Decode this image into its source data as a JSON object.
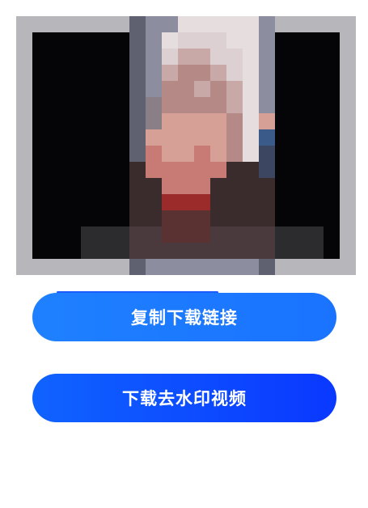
{
  "video_preview": {
    "label": "video-thumbnail",
    "colors": {
      "frame": "#b9b9bd",
      "background": "#000000"
    }
  },
  "actions": {
    "copy_label": "复制下载链接",
    "download_label": "下载去水印视频"
  },
  "colors": {
    "primary": "#1a73ff",
    "download_primary": "#0a38ff"
  }
}
